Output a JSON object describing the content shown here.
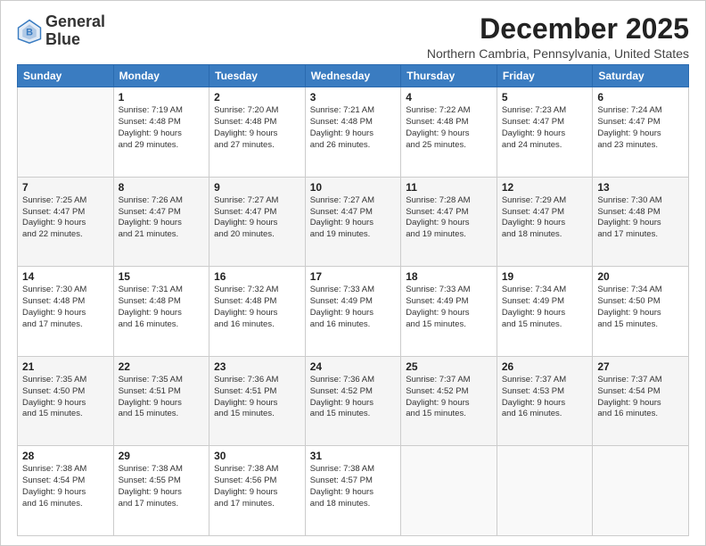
{
  "logo": {
    "line1": "General",
    "line2": "Blue"
  },
  "title": "December 2025",
  "location": "Northern Cambria, Pennsylvania, United States",
  "days_of_week": [
    "Sunday",
    "Monday",
    "Tuesday",
    "Wednesday",
    "Thursday",
    "Friday",
    "Saturday"
  ],
  "weeks": [
    [
      {
        "day": "",
        "info": ""
      },
      {
        "day": "1",
        "info": "Sunrise: 7:19 AM\nSunset: 4:48 PM\nDaylight: 9 hours\nand 29 minutes."
      },
      {
        "day": "2",
        "info": "Sunrise: 7:20 AM\nSunset: 4:48 PM\nDaylight: 9 hours\nand 27 minutes."
      },
      {
        "day": "3",
        "info": "Sunrise: 7:21 AM\nSunset: 4:48 PM\nDaylight: 9 hours\nand 26 minutes."
      },
      {
        "day": "4",
        "info": "Sunrise: 7:22 AM\nSunset: 4:48 PM\nDaylight: 9 hours\nand 25 minutes."
      },
      {
        "day": "5",
        "info": "Sunrise: 7:23 AM\nSunset: 4:47 PM\nDaylight: 9 hours\nand 24 minutes."
      },
      {
        "day": "6",
        "info": "Sunrise: 7:24 AM\nSunset: 4:47 PM\nDaylight: 9 hours\nand 23 minutes."
      }
    ],
    [
      {
        "day": "7",
        "info": "Sunrise: 7:25 AM\nSunset: 4:47 PM\nDaylight: 9 hours\nand 22 minutes."
      },
      {
        "day": "8",
        "info": "Sunrise: 7:26 AM\nSunset: 4:47 PM\nDaylight: 9 hours\nand 21 minutes."
      },
      {
        "day": "9",
        "info": "Sunrise: 7:27 AM\nSunset: 4:47 PM\nDaylight: 9 hours\nand 20 minutes."
      },
      {
        "day": "10",
        "info": "Sunrise: 7:27 AM\nSunset: 4:47 PM\nDaylight: 9 hours\nand 19 minutes."
      },
      {
        "day": "11",
        "info": "Sunrise: 7:28 AM\nSunset: 4:47 PM\nDaylight: 9 hours\nand 19 minutes."
      },
      {
        "day": "12",
        "info": "Sunrise: 7:29 AM\nSunset: 4:47 PM\nDaylight: 9 hours\nand 18 minutes."
      },
      {
        "day": "13",
        "info": "Sunrise: 7:30 AM\nSunset: 4:48 PM\nDaylight: 9 hours\nand 17 minutes."
      }
    ],
    [
      {
        "day": "14",
        "info": "Sunrise: 7:30 AM\nSunset: 4:48 PM\nDaylight: 9 hours\nand 17 minutes."
      },
      {
        "day": "15",
        "info": "Sunrise: 7:31 AM\nSunset: 4:48 PM\nDaylight: 9 hours\nand 16 minutes."
      },
      {
        "day": "16",
        "info": "Sunrise: 7:32 AM\nSunset: 4:48 PM\nDaylight: 9 hours\nand 16 minutes."
      },
      {
        "day": "17",
        "info": "Sunrise: 7:33 AM\nSunset: 4:49 PM\nDaylight: 9 hours\nand 16 minutes."
      },
      {
        "day": "18",
        "info": "Sunrise: 7:33 AM\nSunset: 4:49 PM\nDaylight: 9 hours\nand 15 minutes."
      },
      {
        "day": "19",
        "info": "Sunrise: 7:34 AM\nSunset: 4:49 PM\nDaylight: 9 hours\nand 15 minutes."
      },
      {
        "day": "20",
        "info": "Sunrise: 7:34 AM\nSunset: 4:50 PM\nDaylight: 9 hours\nand 15 minutes."
      }
    ],
    [
      {
        "day": "21",
        "info": "Sunrise: 7:35 AM\nSunset: 4:50 PM\nDaylight: 9 hours\nand 15 minutes."
      },
      {
        "day": "22",
        "info": "Sunrise: 7:35 AM\nSunset: 4:51 PM\nDaylight: 9 hours\nand 15 minutes."
      },
      {
        "day": "23",
        "info": "Sunrise: 7:36 AM\nSunset: 4:51 PM\nDaylight: 9 hours\nand 15 minutes."
      },
      {
        "day": "24",
        "info": "Sunrise: 7:36 AM\nSunset: 4:52 PM\nDaylight: 9 hours\nand 15 minutes."
      },
      {
        "day": "25",
        "info": "Sunrise: 7:37 AM\nSunset: 4:52 PM\nDaylight: 9 hours\nand 15 minutes."
      },
      {
        "day": "26",
        "info": "Sunrise: 7:37 AM\nSunset: 4:53 PM\nDaylight: 9 hours\nand 16 minutes."
      },
      {
        "day": "27",
        "info": "Sunrise: 7:37 AM\nSunset: 4:54 PM\nDaylight: 9 hours\nand 16 minutes."
      }
    ],
    [
      {
        "day": "28",
        "info": "Sunrise: 7:38 AM\nSunset: 4:54 PM\nDaylight: 9 hours\nand 16 minutes."
      },
      {
        "day": "29",
        "info": "Sunrise: 7:38 AM\nSunset: 4:55 PM\nDaylight: 9 hours\nand 17 minutes."
      },
      {
        "day": "30",
        "info": "Sunrise: 7:38 AM\nSunset: 4:56 PM\nDaylight: 9 hours\nand 17 minutes."
      },
      {
        "day": "31",
        "info": "Sunrise: 7:38 AM\nSunset: 4:57 PM\nDaylight: 9 hours\nand 18 minutes."
      },
      {
        "day": "",
        "info": ""
      },
      {
        "day": "",
        "info": ""
      },
      {
        "day": "",
        "info": ""
      }
    ]
  ]
}
